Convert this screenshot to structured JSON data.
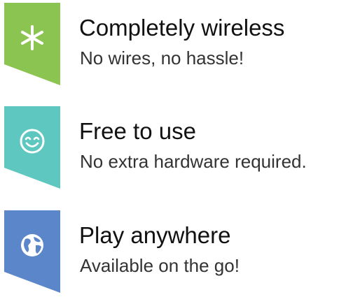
{
  "features": [
    {
      "title": "Completely wireless",
      "subtitle": "No wires, no hassle!",
      "icon": "asterisk-icon",
      "color": "#8cc452"
    },
    {
      "title": "Free to use",
      "subtitle": "No extra hardware required.",
      "icon": "smiley-icon",
      "color": "#5ec8c0"
    },
    {
      "title": "Play anywhere",
      "subtitle": "Available on the go!",
      "icon": "globe-icon",
      "color": "#5b86c9"
    }
  ]
}
